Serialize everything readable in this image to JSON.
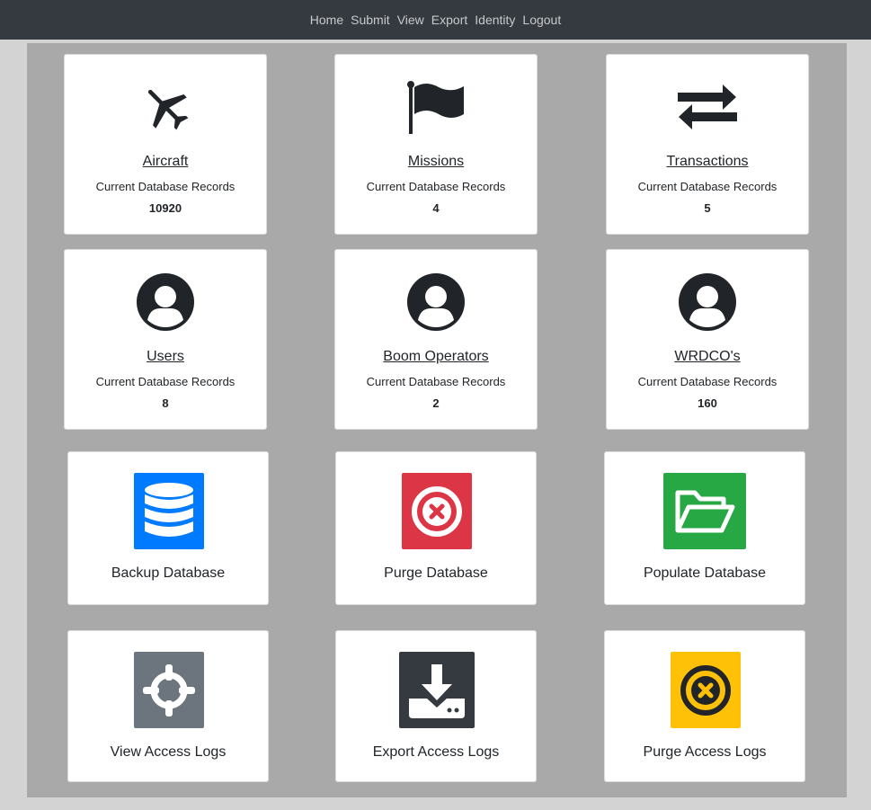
{
  "nav": {
    "items": [
      "Home",
      "Submit",
      "View",
      "Export",
      "Identity",
      "Logout"
    ]
  },
  "stats": [
    {
      "title": "Aircraft",
      "subtitle": "Current Database Records",
      "value": "10920",
      "icon": "airplane-icon"
    },
    {
      "title": "Missions",
      "subtitle": "Current Database Records",
      "value": "4",
      "icon": "flag-icon"
    },
    {
      "title": "Transactions",
      "subtitle": "Current Database Records",
      "value": "5",
      "icon": "exchange-arrows-icon"
    },
    {
      "title": "Users",
      "subtitle": "Current Database Records",
      "value": "8",
      "icon": "user-circle-icon"
    },
    {
      "title": "Boom Operators",
      "subtitle": "Current Database Records",
      "value": "2",
      "icon": "user-circle-icon"
    },
    {
      "title": "WRDCO's",
      "subtitle": "Current Database Records",
      "value": "160",
      "icon": "user-circle-icon"
    }
  ],
  "actions": [
    {
      "label": "Backup Database",
      "icon": "database-icon",
      "color": "#007bff"
    },
    {
      "label": "Purge Database",
      "icon": "x-circle-icon",
      "color": "#dc3545"
    },
    {
      "label": "Populate Database",
      "icon": "folder-open-icon",
      "color": "#28a745"
    },
    {
      "label": "View Access Logs",
      "icon": "crosshairs-icon",
      "color": "#6c757d"
    },
    {
      "label": "Export Access Logs",
      "icon": "download-icon",
      "color": "#343a40"
    },
    {
      "label": "Purge Access Logs",
      "icon": "x-circle-icon",
      "color": "#ffc107"
    }
  ]
}
